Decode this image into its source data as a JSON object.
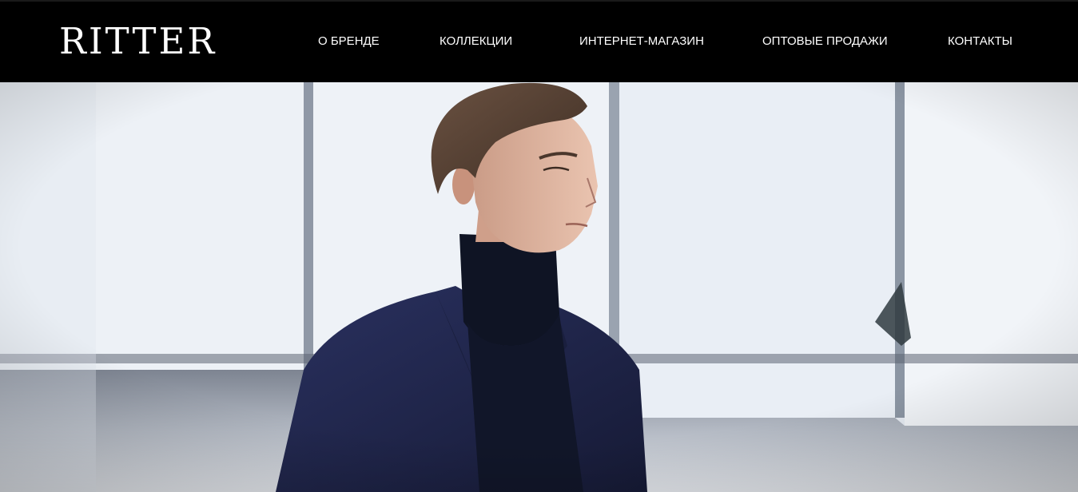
{
  "header": {
    "logo_text": "RITTER",
    "background": "#000000",
    "nav": [
      {
        "label": "О БРЕНДЕ"
      },
      {
        "label": "КОЛЛЕКЦИИ"
      },
      {
        "label": "ИНТЕРНЕТ-МАГАЗИН"
      },
      {
        "label": "ОПТОВЫЕ ПРОДАЖИ"
      },
      {
        "label": "КОНТАКТЫ"
      }
    ]
  },
  "hero": {
    "image": "photo-man-in-navy-suit-and-black-turtleneck",
    "colors": {
      "suit": "#1f2446",
      "turtleneck": "#0f1424",
      "sky": "#e9eef5"
    }
  }
}
